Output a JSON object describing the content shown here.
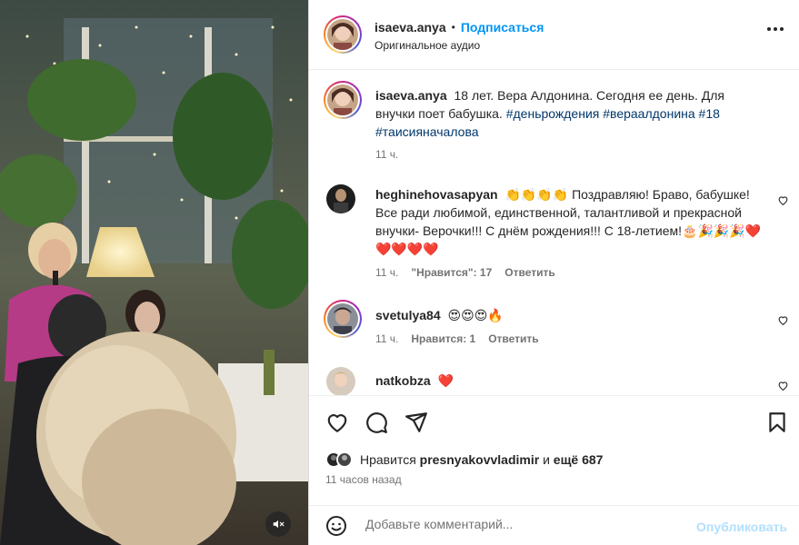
{
  "post": {
    "author": "isaeva.anya",
    "follow_label": "Подписаться",
    "separator": "•",
    "audio": "Оригинальное аудио",
    "more_icon": "more-horizontal-icon"
  },
  "caption": {
    "username": "isaeva.anya",
    "text": "18 лет. Вера Алдонина. Сегодня ее день. Для внучки поет бабушка.",
    "hashtags": [
      "#деньрождения",
      "#вераалдонина",
      "#18",
      "#таисияначалова"
    ],
    "time": "11 ч."
  },
  "comments": [
    {
      "username": "heghinehovasapyan",
      "emoji_prefix": "👏👏👏👏",
      "text": "Поздравляю! Браво, бабушке! Все ради любимой, единственной, талантливой и прекрасной внучки- Верочки!!! С днём рождения!!! С 18-летием!🎂🎉🎉🎉❤️❤️❤️❤️❤️",
      "time": "11 ч.",
      "likes": "\"Нравится\": 17",
      "reply": "Ответить"
    },
    {
      "username": "svetulya84",
      "text": "😍😍😍🔥",
      "time": "11 ч.",
      "likes": "Нравится: 1",
      "reply": "Ответить"
    },
    {
      "username": "natkobza",
      "text": "❤️"
    }
  ],
  "actions": {
    "like_icon": "heart-icon",
    "comment_icon": "comment-icon",
    "share_icon": "share-icon",
    "save_icon": "bookmark-icon"
  },
  "likes_summary": {
    "prefix": "Нравится",
    "user": "presnyakovvladimir",
    "and": "и",
    "others": "ещё 687"
  },
  "time_ago": "11 часов назад",
  "comment_box": {
    "placeholder": "Добавьте комментарий...",
    "publish": "Опубликовать",
    "emoji_icon": "smiley-icon"
  },
  "media": {
    "mute_icon": "volume-muted-icon"
  },
  "colors": {
    "link": "#0095f6",
    "hashtag": "#00376b",
    "heart": "#ed4956",
    "muted": "#737373",
    "publish_disabled": "#b2dffc"
  }
}
